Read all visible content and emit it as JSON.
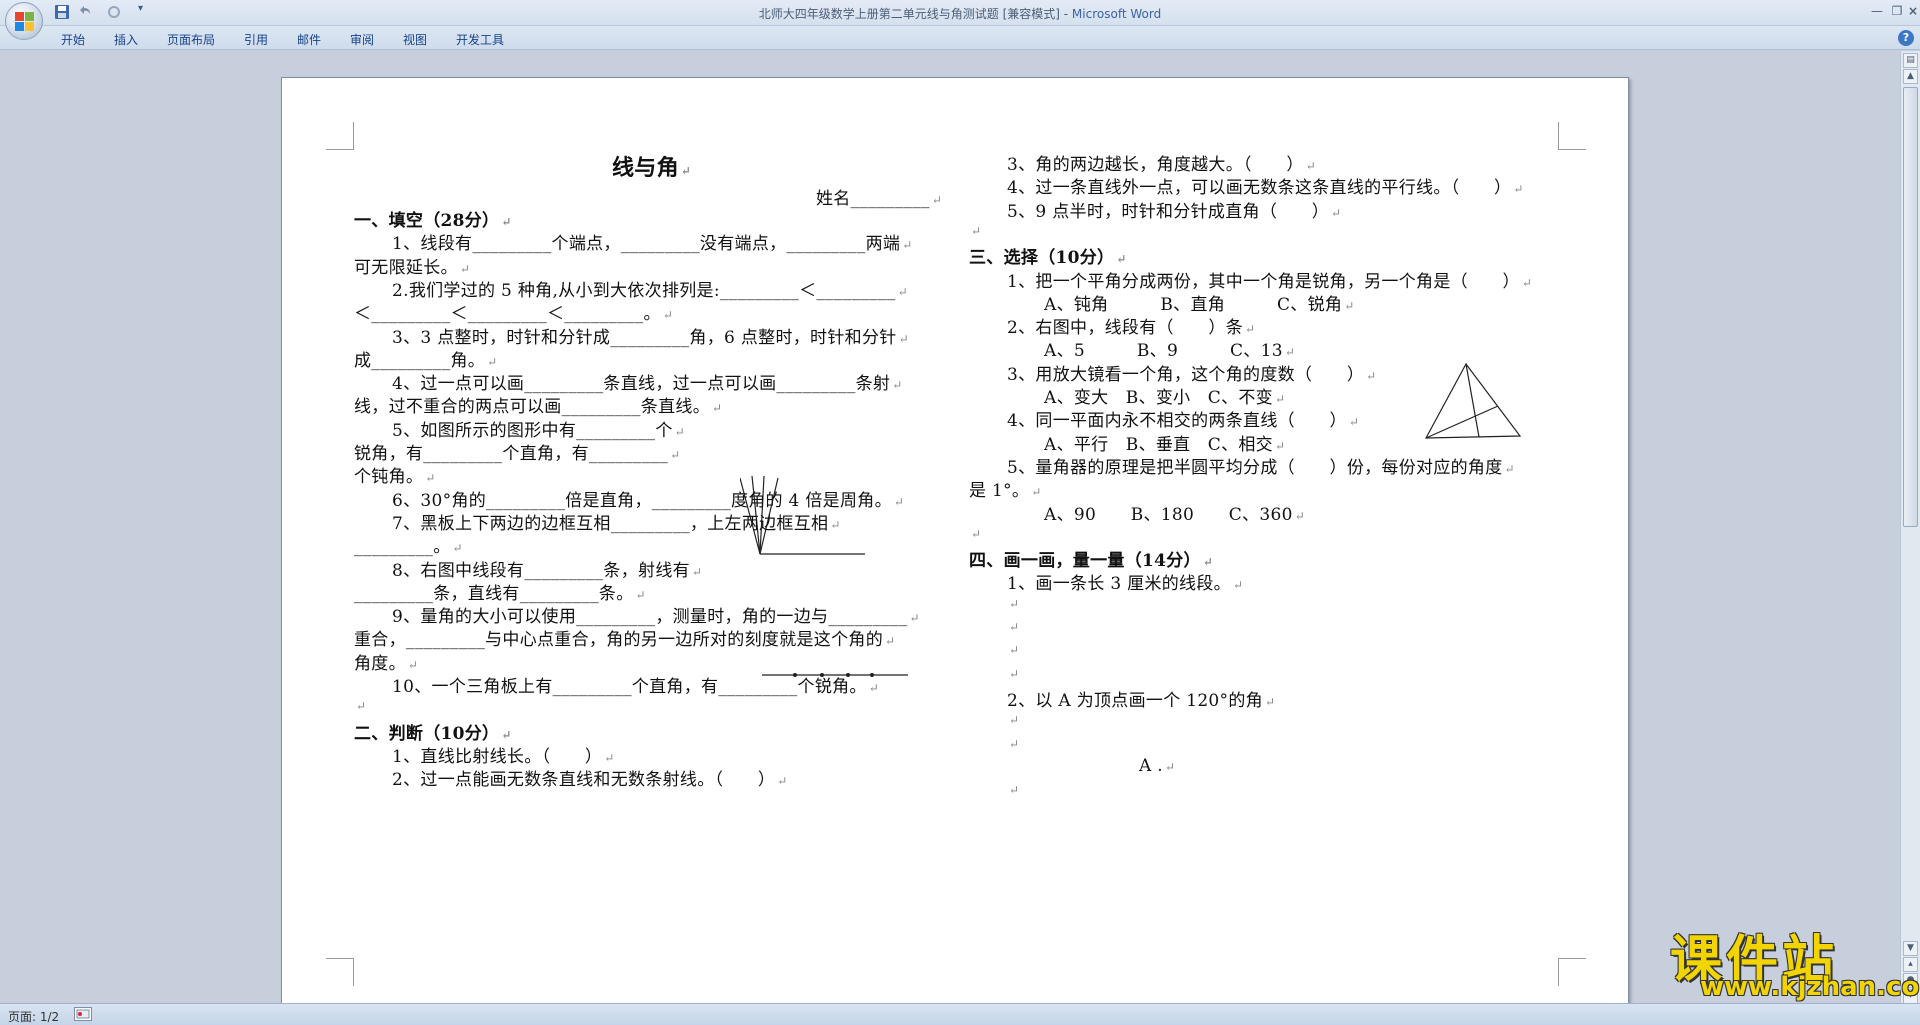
{
  "window": {
    "doc_title": "北师大四年级数学上册第二单元线与角测试题 [兼容模式] - ",
    "app_name": "Microsoft Word"
  },
  "ribbon": {
    "tabs": [
      "开始",
      "插入",
      "页面布局",
      "引用",
      "邮件",
      "审阅",
      "视图",
      "开发工具"
    ]
  },
  "status": {
    "page": "页面: 1/2"
  },
  "watermark": {
    "brand": "课件站",
    "url": "www.kjzhan.com"
  },
  "document": {
    "title": "线与角",
    "name_line": "姓名_________",
    "left_lines": [
      {
        "t": "一、填空（28分）",
        "bold": true
      },
      {
        "t": "1、线段有_________个端点，_________没有端点，_________两端"
      },
      {
        "t": "可无限延长。"
      },
      {
        "t": "2.我们学过的 5 种角,从小到大依次排列是:_________＜_________"
      },
      {
        "t": "＜_________＜_________＜_________。"
      },
      {
        "t": "3、3 点整时，时针和分针成_________角，6 点整时，时针和分针"
      },
      {
        "t": "成_________角。"
      },
      {
        "t": "4、过一点可以画_________条直线，过一点可以画_________条射"
      },
      {
        "t": "线，过不重合的两点可以画_________条直线。"
      },
      {
        "t": "5、如图所示的图形中有_________个"
      },
      {
        "t": "锐角，有_________个直角，有_________"
      },
      {
        "t": "个钝角。"
      },
      {
        "t": "6、30°角的_________倍是直角，_________度角的 4 倍是周角。"
      },
      {
        "t": "7、黑板上下两边的边框互相_________，上左两边框互相"
      },
      {
        "t": "_________。"
      },
      {
        "t": "8、右图中线段有_________条，射线有"
      },
      {
        "t": "_________条，直线有_________条。"
      },
      {
        "t": "9、量角的大小可以使用_________，测量时，角的一边与_________"
      },
      {
        "t": "重合，_________与中心点重合，角的另一边所对的刻度就是这个角的"
      },
      {
        "t": "角度。"
      },
      {
        "t": "10、一个三角板上有_________个直角，有_________个锐角。"
      },
      {
        "t": ""
      },
      {
        "t": "二、判断（10分）",
        "bold": true
      },
      {
        "t": "1、直线比射线长。（　　）"
      },
      {
        "t": "2、过一点能画无数条直线和无数条射线。（　　）"
      }
    ],
    "right_lines": [
      {
        "t": "3、角的两边越长，角度越大。（　　）"
      },
      {
        "t": "4、过一条直线外一点，可以画无数条这条直线的平行线。（　　）"
      },
      {
        "t": "5、9 点半时，时针和分针成直角（　　）"
      },
      {
        "t": ""
      },
      {
        "t": "三、选择（10分）",
        "bold": true
      },
      {
        "t": "1、把一个平角分成两份，其中一个角是锐角，另一个角是（　　）"
      },
      {
        "t": "A、钝角　　　B、直角　　　C、锐角"
      },
      {
        "t": "2、右图中，线段有（　　）条"
      },
      {
        "t": "A、5　　　B、9　　　C、13"
      },
      {
        "t": "3、用放大镜看一个角，这个角的度数（　　）"
      },
      {
        "t": "A、变大　B、变小　C、不变"
      },
      {
        "t": "4、同一平面内永不相交的两条直线（　　）"
      },
      {
        "t": "A、平行　B、垂直　C、相交"
      },
      {
        "t": "5、量角器的原理是把半圆平均分成（　　）份，每份对应的角度"
      },
      {
        "t": "是 1°。"
      },
      {
        "t": "A、90　　B、180　　C、360"
      },
      {
        "t": ""
      },
      {
        "t": "四、画一画，量一量（14分）",
        "bold": true
      },
      {
        "t": "1、画一条长 3 厘米的线段。"
      },
      {
        "t": ""
      },
      {
        "t": ""
      },
      {
        "t": ""
      },
      {
        "t": ""
      },
      {
        "t": "2、以 A 为顶点画一个 120°的角"
      },
      {
        "t": ""
      },
      {
        "t": ""
      },
      {
        "t": "A ."
      },
      {
        "t": ""
      }
    ]
  }
}
